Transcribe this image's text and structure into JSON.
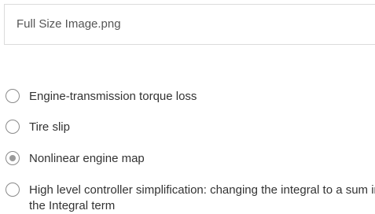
{
  "attachment": {
    "file_name": "Full Size Image.png"
  },
  "question": {
    "options": [
      {
        "label": "Engine-transmission torque loss",
        "selected": false
      },
      {
        "label": "Tire slip",
        "selected": false
      },
      {
        "label": "Nonlinear engine map",
        "selected": true
      },
      {
        "label": "High level controller simplification: changing the integral to a sum in the Integral term",
        "selected": false
      }
    ]
  }
}
